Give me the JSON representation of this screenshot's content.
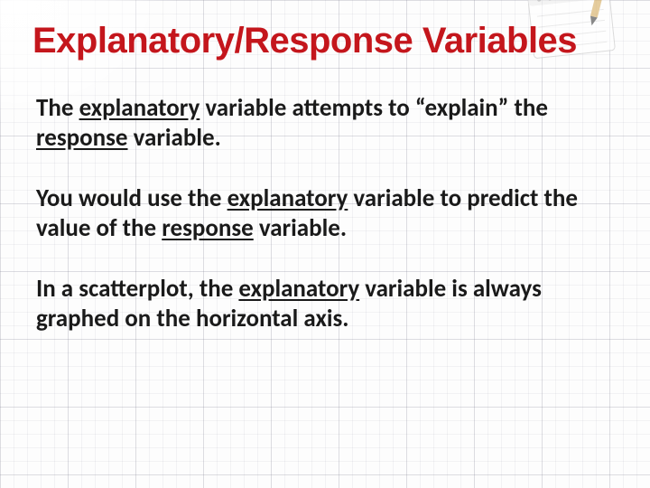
{
  "title": "Explanatory/Response Variables",
  "para1": {
    "pre": "The ",
    "u1": "explanatory",
    "mid1": " variable attempts to “explain” the ",
    "u2": "response",
    "post": " variable."
  },
  "para2": {
    "pre": "You would use the ",
    "u1": "explanatory",
    "mid1": " variable to predict the value of the ",
    "u2": "response",
    "post": " variable."
  },
  "para3": {
    "pre": "In a scatterplot, the ",
    "u1": "explanatory",
    "post": " variable is always graphed on the horizontal axis."
  }
}
